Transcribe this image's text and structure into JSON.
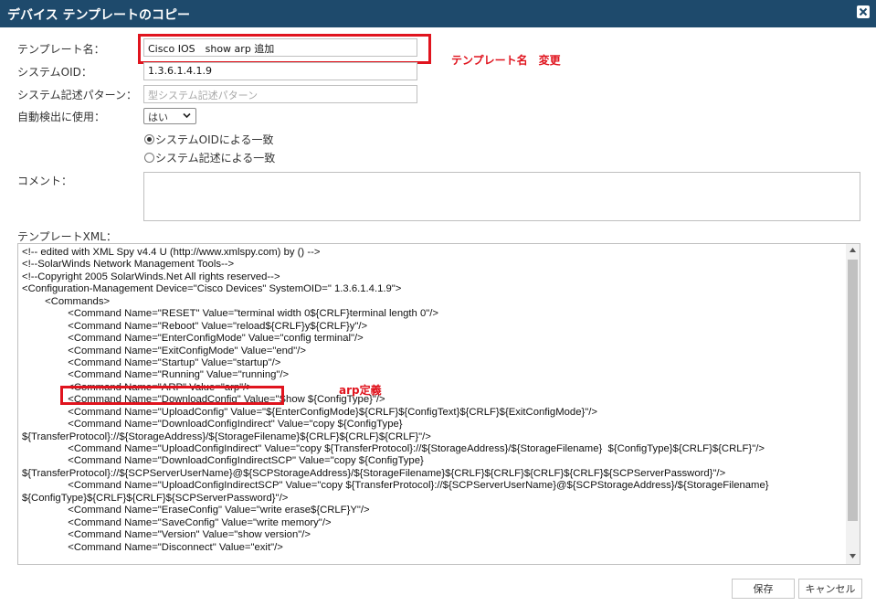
{
  "dialog": {
    "title": "デバイス テンプレートのコピー"
  },
  "form": {
    "template_name_label": "テンプレート名：",
    "template_name_value": "Cisco IOS　show arp 追加",
    "system_oid_label": "システムOID：",
    "system_oid_value": "1.3.6.1.4.1.9",
    "sysdescr_label": "システム記述パターン：",
    "sysdescr_placeholder": "型システム記述パターン",
    "auto_detect_label": "自動検出に使用：",
    "auto_detect_value": "はい",
    "radio_oid_label": "システムOIDによる一致",
    "radio_descr_label": "システム記述による一致",
    "comment_label": "コメント：",
    "comment_value": "",
    "xml_label": "テンプレートXML："
  },
  "annotations": {
    "name_change": "テンプレート名　変更",
    "arp_def": "arp定義",
    "color": "#e0141e"
  },
  "xml_lines": [
    "<!-- edited with XML Spy v4.4 U (http://www.xmlspy.com) by () -->",
    "<!--SolarWinds Network Management Tools-->",
    "<!--Copyright 2005 SolarWinds.Net All rights reserved-->",
    "<Configuration-Management Device=\"Cisco Devices\" SystemOID=\" 1.3.6.1.4.1.9\">",
    "        <Commands>",
    "                <Command Name=\"RESET\" Value=\"terminal width 0${CRLF}terminal length 0\"/>",
    "                <Command Name=\"Reboot\" Value=\"reload${CRLF}y${CRLF}y\"/>",
    "                <Command Name=\"EnterConfigMode\" Value=\"config terminal\"/>",
    "                <Command Name=\"ExitConfigMode\" Value=\"end\"/>",
    "                <Command Name=\"Startup\" Value=\"startup\"/>",
    "                <Command Name=\"Running\" Value=\"running\"/>",
    "                <Command Name=\"ARP\" Value=\"arp\"/>",
    "                <Command Name=\"DownloadConfig\" Value=\"Show ${ConfigType}\"/>",
    "                <Command Name=\"UploadConfig\" Value=\"${EnterConfigMode}${CRLF}${ConfigText}${CRLF}${ExitConfigMode}\"/>",
    "                <Command Name=\"DownloadConfigIndirect\" Value=\"copy ${ConfigType}",
    "${TransferProtocol}://${StorageAddress}/${StorageFilename}${CRLF}${CRLF}${CRLF}\"/>",
    "                <Command Name=\"UploadConfigIndirect\" Value=\"copy ${TransferProtocol}://${StorageAddress}/${StorageFilename}  ${ConfigType}${CRLF}${CRLF}\"/>",
    "                <Command Name=\"DownloadConfigIndirectSCP\" Value=\"copy ${ConfigType}",
    "${TransferProtocol}://${SCPServerUserName}@${SCPStorageAddress}/${StorageFilename}${CRLF}${CRLF}${CRLF}${CRLF}${SCPServerPassword}\"/>",
    "                <Command Name=\"UploadConfigIndirectSCP\" Value=\"copy ${TransferProtocol}://${SCPServerUserName}@${SCPStorageAddress}/${StorageFilename}",
    "${ConfigType}${CRLF}${CRLF}${SCPServerPassword}\"/>",
    "                <Command Name=\"EraseConfig\" Value=\"write erase${CRLF}Y\"/>",
    "                <Command Name=\"SaveConfig\" Value=\"write memory\"/>",
    "                <Command Name=\"Version\" Value=\"show version\"/>",
    "                <Command Name=\"Disconnect\" Value=\"exit\"/>"
  ],
  "buttons": {
    "save": "保存",
    "cancel": "キャンセル"
  }
}
